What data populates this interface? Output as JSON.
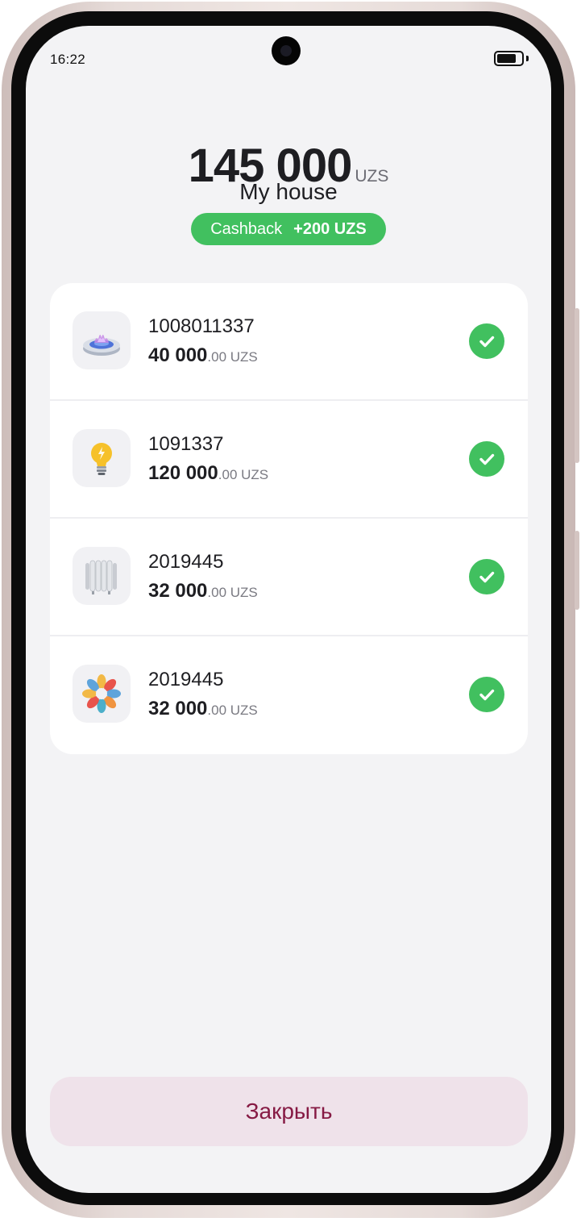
{
  "status_bar": {
    "time": "16:22",
    "camera_icon": "front-camera-icon",
    "battery_icon": "battery-icon"
  },
  "summary": {
    "total_amount": "145 000",
    "currency": "UZS",
    "title": "My house",
    "cashback_label": "Cashback",
    "cashback_value": "+200 UZS"
  },
  "payments": [
    {
      "icon": "gas-burner-icon",
      "account": "1008011337",
      "amount_main": "40 000",
      "amount_rest": ".00 UZS",
      "status_icon": "check-icon"
    },
    {
      "icon": "light-bulb-icon",
      "account": "1091337",
      "amount_main": "120 000",
      "amount_rest": ".00 UZS",
      "status_icon": "check-icon"
    },
    {
      "icon": "radiator-icon",
      "account": "2019445",
      "amount_main": "32 000",
      "amount_rest": ".00 UZS",
      "status_icon": "check-icon"
    },
    {
      "icon": "colorful-ring-icon",
      "account": "2019445",
      "amount_main": "32 000",
      "amount_rest": ".00 UZS",
      "status_icon": "check-icon"
    }
  ],
  "footer": {
    "close_label": "Закрыть"
  },
  "colors": {
    "accent_green": "#41c05f",
    "background": "#f3f3f5",
    "close_button_bg": "#efe2ea",
    "close_button_text": "#861a44"
  }
}
